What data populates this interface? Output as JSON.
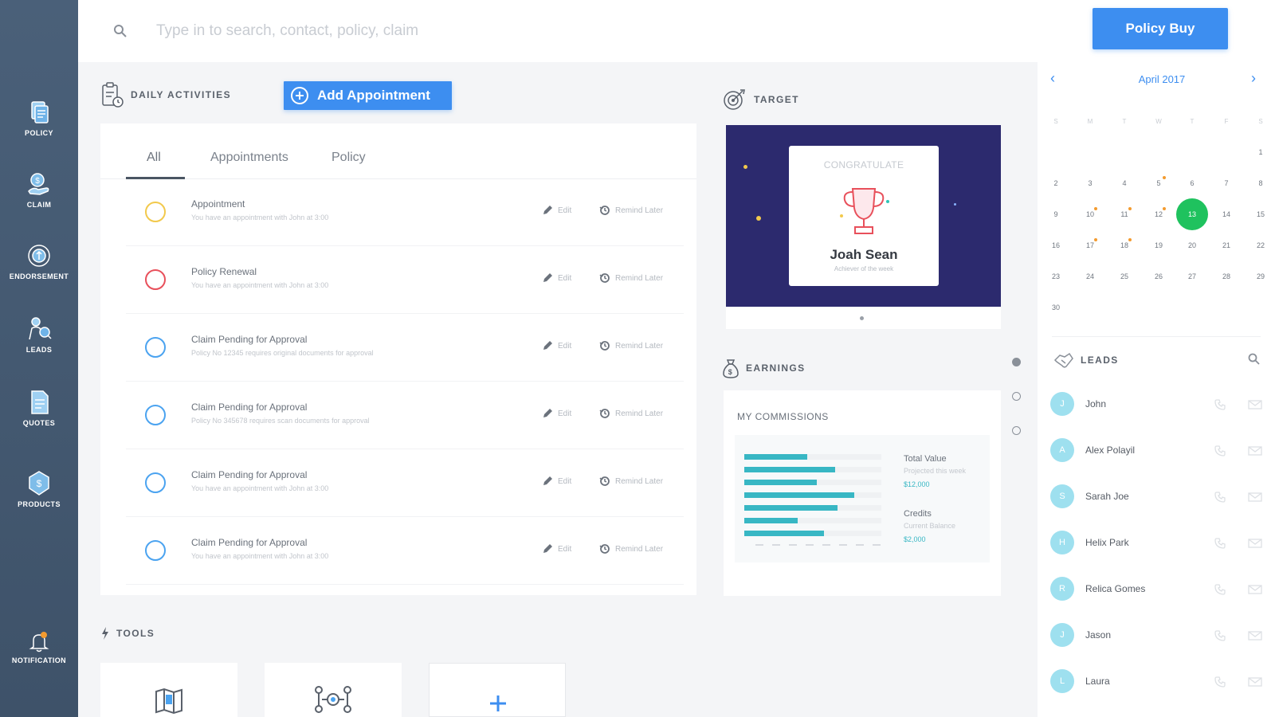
{
  "sidebar": {
    "items": [
      {
        "label": "POLICY",
        "icon": "policy-icon"
      },
      {
        "label": "CLAIM",
        "icon": "claim-icon"
      },
      {
        "label": "ENDORSEMENT",
        "icon": "endorsement-icon"
      },
      {
        "label": "LEADS",
        "icon": "leads-icon"
      },
      {
        "label": "QUOTES",
        "icon": "quotes-icon"
      },
      {
        "label": "PRODUCTS",
        "icon": "products-icon"
      }
    ],
    "notification": {
      "label": "NOTIFICATION",
      "icon": "bell-icon"
    }
  },
  "header": {
    "search_placeholder": "Type in to search, contact, policy, claim",
    "policy_buy_label": "Policy Buy"
  },
  "daily_activities": {
    "title": "DAILY ACTIVITIES",
    "add_label": "Add Appointment",
    "tabs": [
      "All",
      "Appointments",
      "Policy"
    ],
    "active_tab": "All",
    "edit_label": "Edit",
    "remind_label": "Remind Later",
    "items": [
      {
        "title": "Appointment",
        "desc": "You have an appointment with John at 3:00",
        "color": "#f2c94c"
      },
      {
        "title": "Policy Renewal",
        "desc": "You have an appointment with John at 3:00",
        "color": "#e8505b"
      },
      {
        "title": "Claim Pending for Approval",
        "desc": "Policy No 12345 requires original documents for approval",
        "color": "#4ba3f0"
      },
      {
        "title": "Claim Pending for Approval",
        "desc": "Policy No 345678 requires scan documents for approval",
        "color": "#4ba3f0"
      },
      {
        "title": "Claim Pending for Approval",
        "desc": "You have an appointment with John at 3:00",
        "color": "#4ba3f0"
      },
      {
        "title": "Claim Pending for Approval",
        "desc": "You have an appointment with John at 3:00",
        "color": "#4ba3f0"
      }
    ]
  },
  "target": {
    "title": "TARGET",
    "card_label": "CONGRATULATE",
    "name": "Joah Sean",
    "subtitle": "Achiever of the week"
  },
  "earnings": {
    "title": "EARNINGS",
    "card_title": "MY COMMISSIONS",
    "bars": [
      0.46,
      0.66,
      0.53,
      0.8,
      0.68,
      0.39,
      0.58
    ],
    "total": {
      "label": "Total Value",
      "sub": "Projected this week",
      "value": "$12,000"
    },
    "credits": {
      "label": "Credits",
      "sub": "Current Balance",
      "value": "$2,000"
    }
  },
  "tools": {
    "title": "TOOLS",
    "items": [
      {
        "icon": "map-icon"
      },
      {
        "icon": "workflow-icon"
      },
      {
        "icon": "plus-icon"
      }
    ]
  },
  "calendar": {
    "month_label": "April 2017",
    "weekdays": [
      "S",
      "M",
      "T",
      "W",
      "T",
      "F",
      "S"
    ],
    "days": [
      "1",
      "2",
      "3",
      "4",
      "5",
      "6",
      "7",
      "8",
      "9",
      "10",
      "11",
      "12",
      "13",
      "14",
      "15",
      "16",
      "17",
      "18",
      "19",
      "20",
      "21",
      "22",
      "23",
      "24",
      "25",
      "26",
      "27",
      "28",
      "29",
      "30"
    ],
    "first_weekday": 6,
    "today": "13",
    "event_days": [
      "5",
      "10",
      "11",
      "12",
      "17",
      "18"
    ],
    "accent": "#3d8ef0",
    "today_color": "#1fc25e"
  },
  "leads": {
    "title": "LEADS",
    "items": [
      {
        "name": "John",
        "initial": "J"
      },
      {
        "name": "Alex Polayil",
        "initial": "A"
      },
      {
        "name": "Sarah Joe",
        "initial": "S"
      },
      {
        "name": "Helix Park",
        "initial": "H"
      },
      {
        "name": "Relica Gomes",
        "initial": "R"
      },
      {
        "name": "Jason",
        "initial": "J"
      },
      {
        "name": "Laura",
        "initial": "L"
      }
    ]
  }
}
